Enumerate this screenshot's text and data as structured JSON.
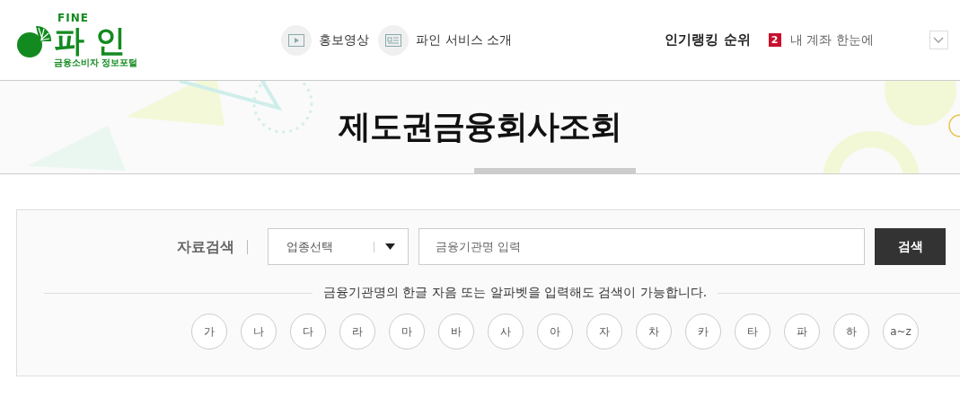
{
  "logo": {
    "top": "FINE",
    "name": "파 인",
    "tagline": "금융소비자 정보포털"
  },
  "nav": [
    {
      "kind": "video",
      "label": "홍보영상"
    },
    {
      "kind": "doc",
      "label": "파인 서비스 소개"
    }
  ],
  "ranking": {
    "title": "인기랭킹 순위",
    "rank": "2",
    "item": "내 계좌 한눈에"
  },
  "banner": {
    "title": "제도권금융회사조회"
  },
  "search": {
    "label": "자료검색",
    "select": "업종선택",
    "placeholder": "금융기관명 입력",
    "button": "검색"
  },
  "hint": "금융기관명의 한글 자음 또는 알파벳을 입력해도 검색이 가능합니다.",
  "letters": [
    "가",
    "나",
    "다",
    "라",
    "마",
    "바",
    "사",
    "아",
    "자",
    "차",
    "카",
    "타",
    "파",
    "하",
    "a~z"
  ]
}
